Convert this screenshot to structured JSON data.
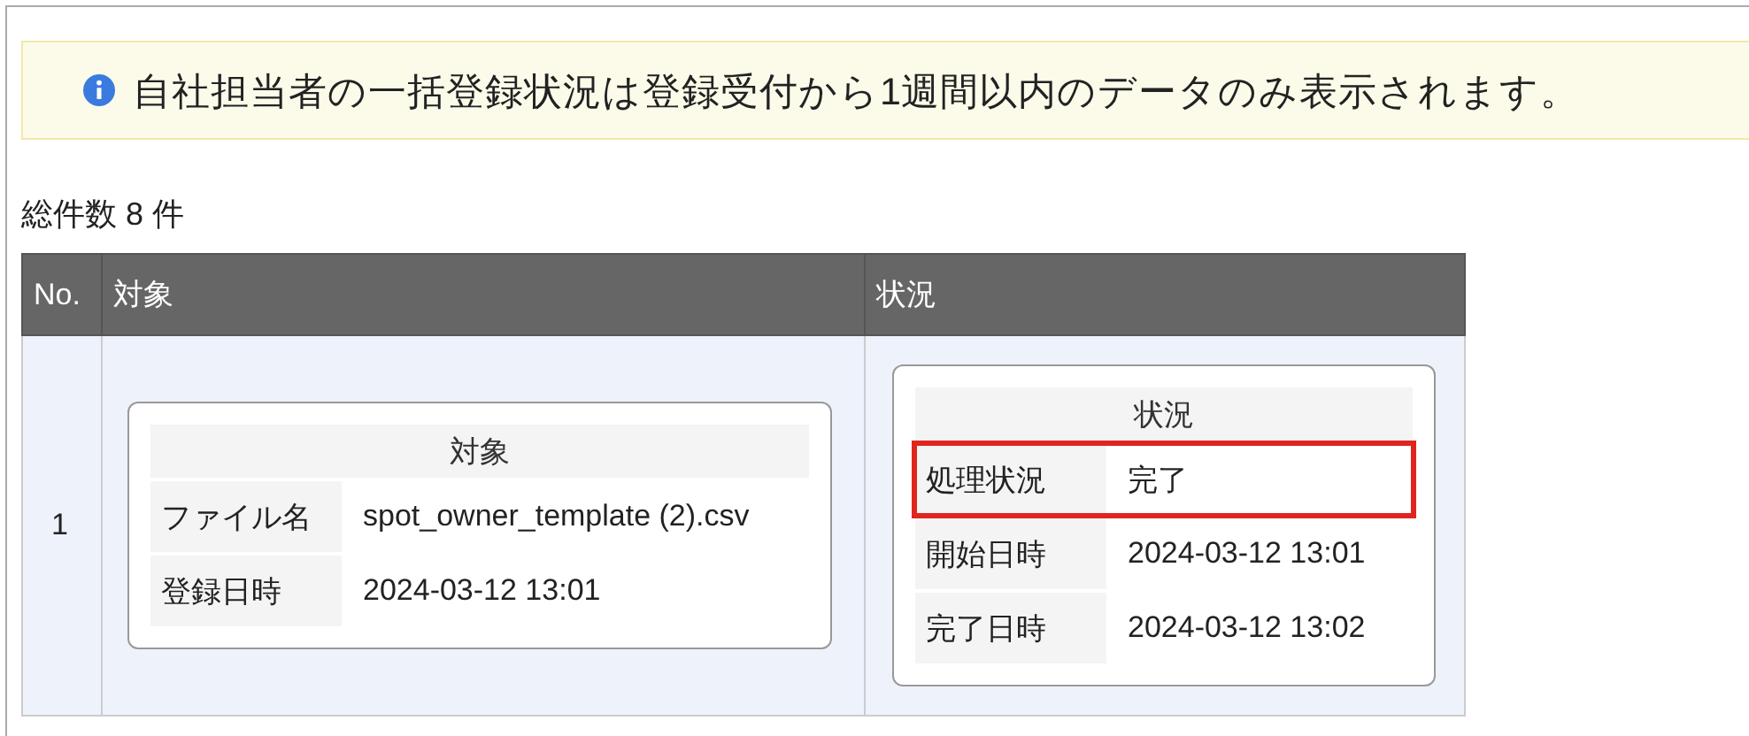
{
  "notice": {
    "text": "自社担当者の一括登録状況は登録受付から1週間以内のデータのみ表示されます。"
  },
  "total_count": "総件数 8 件",
  "table": {
    "columns": [
      "No.",
      "対象",
      "状況"
    ],
    "rows": [
      {
        "no": "1",
        "target": {
          "title": "対象",
          "fields": [
            {
              "label": "ファイル名",
              "value": "spot_owner_template (2).csv",
              "highlighted": false
            },
            {
              "label": "登録日時",
              "value": "2024-03-12 13:01",
              "highlighted": false
            }
          ]
        },
        "status": {
          "title": "状況",
          "fields": [
            {
              "label": "処理状況",
              "value": "完了",
              "highlighted": true
            },
            {
              "label": "開始日時",
              "value": "2024-03-12 13:01",
              "highlighted": false
            },
            {
              "label": "完了日時",
              "value": "2024-03-12 13:02",
              "highlighted": false
            }
          ]
        }
      }
    ]
  }
}
